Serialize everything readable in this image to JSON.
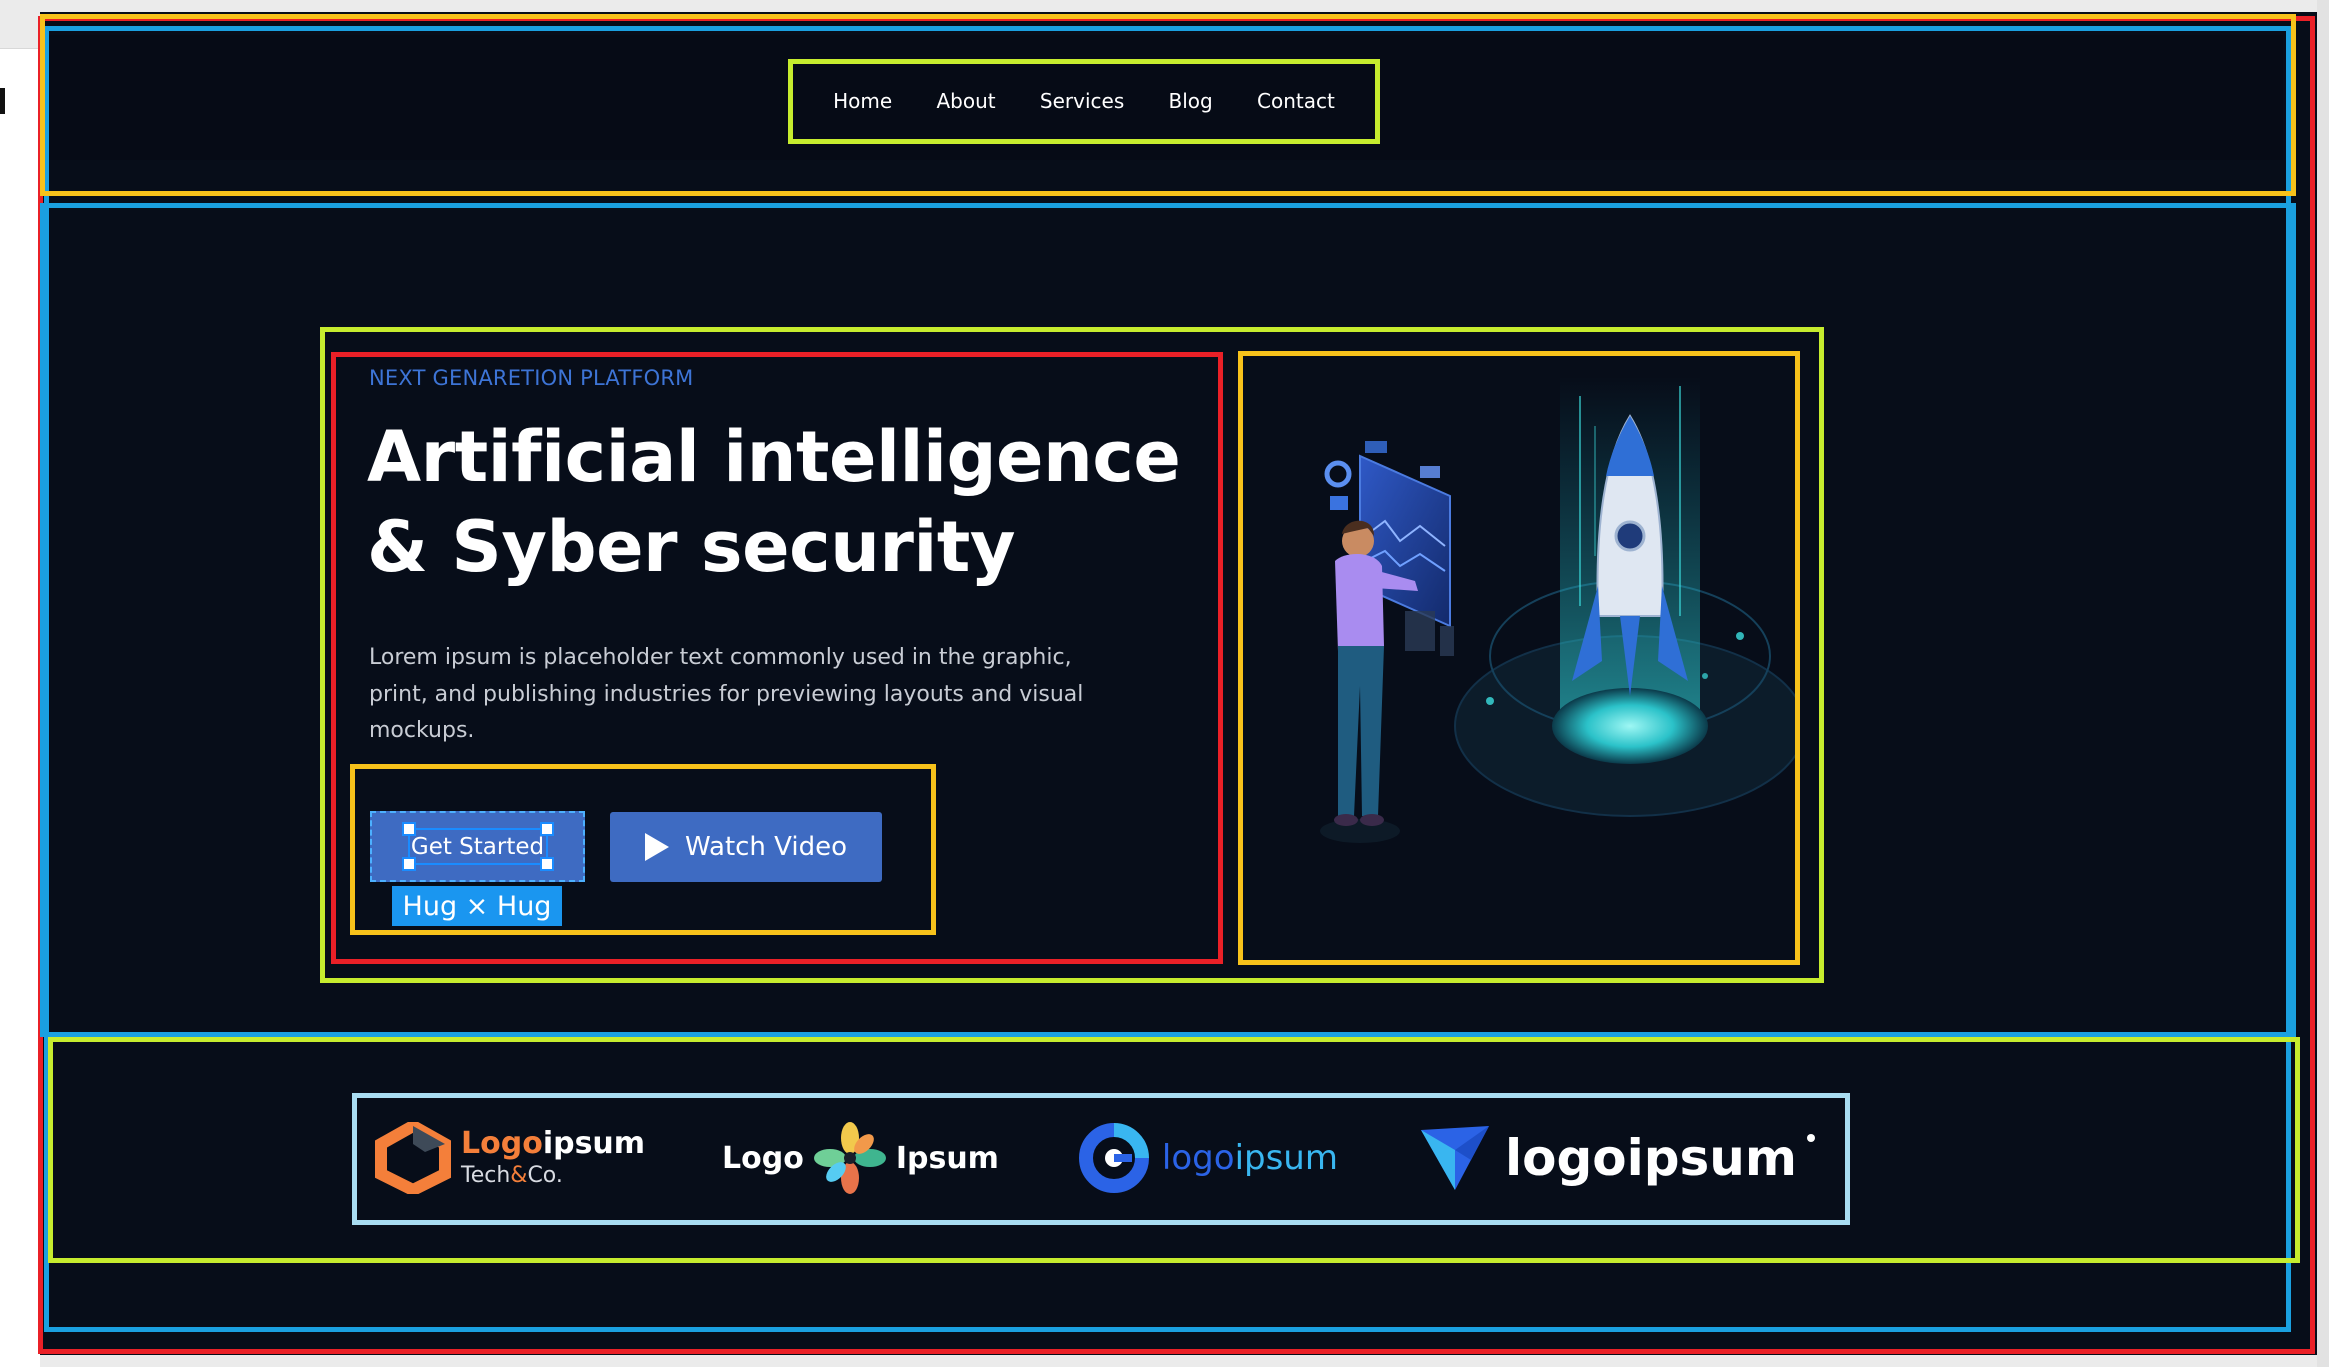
{
  "nav": {
    "items": [
      {
        "label": "Home"
      },
      {
        "label": "About"
      },
      {
        "label": "Services"
      },
      {
        "label": "Blog"
      },
      {
        "label": "Contact"
      }
    ]
  },
  "hero": {
    "eyebrow": "NEXT GENARETION PLATFORM",
    "headline_line1": "Artificial intelligence",
    "headline_line2": "& Syber security",
    "body": "Lorem ipsum is placeholder text commonly used in the graphic, print, and publishing industries for previewing layouts and visual mockups.",
    "primary_button": "Get Started",
    "secondary_button": "Watch Video",
    "size_badge": "Hug × Hug"
  },
  "logos": {
    "logo1_part1": "Logo",
    "logo1_part2": "ipsum",
    "logo1_sub_part1": "Tech",
    "logo1_sub_amp": "&",
    "logo1_sub_part2": "Co.",
    "logo2_left": "Logo",
    "logo2_right": "Ipsum",
    "logo3_part1": "logo",
    "logo3_part2": "ipsum",
    "logo4": "logoipsum"
  },
  "colors": {
    "page_bg": "#070d19",
    "accent": "#3e6bc2",
    "eyebrow": "#3d74d6",
    "selection": "#1a96f0",
    "logo1_orange": "#f47f3a",
    "logo3_blue": "#2b63e6",
    "logo3_light": "#39b6f0"
  }
}
